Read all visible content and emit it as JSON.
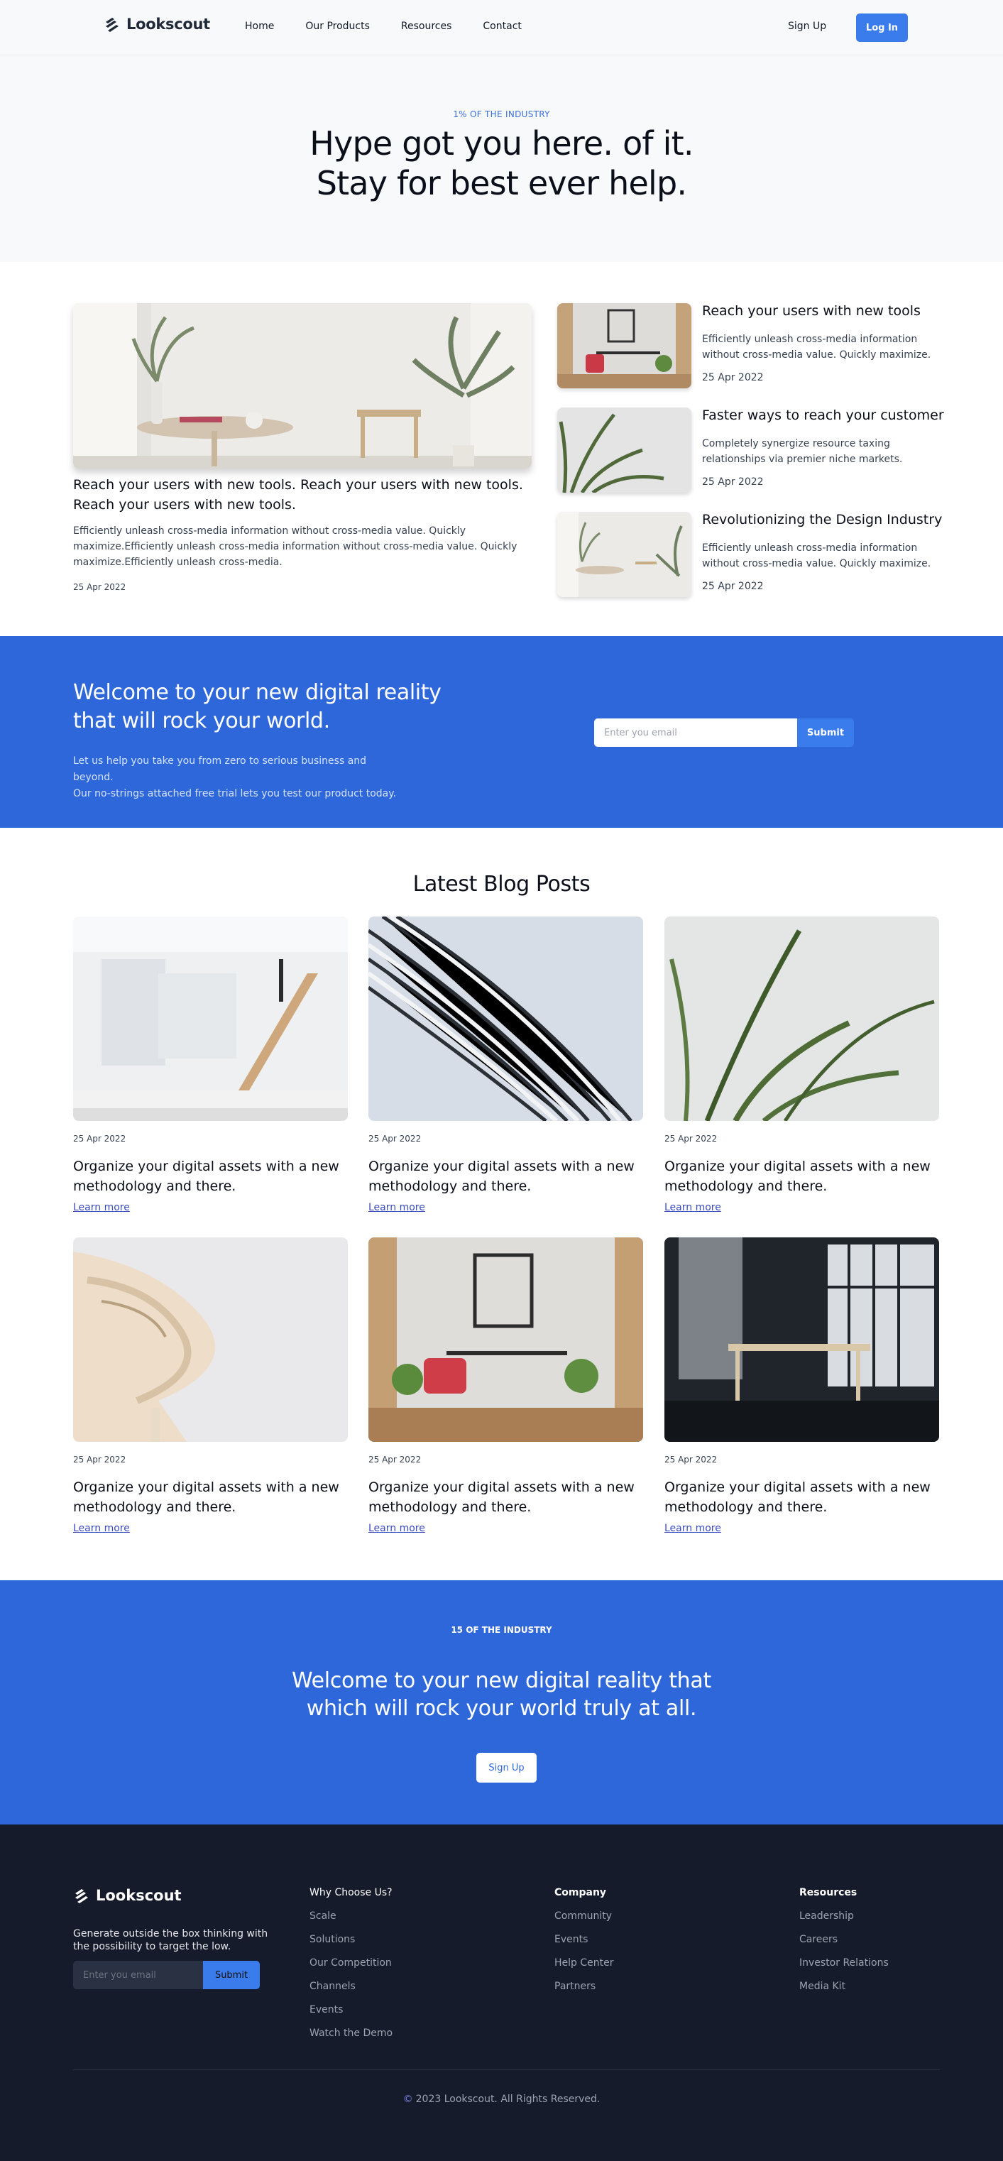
{
  "nav": {
    "brand": "Lookscout",
    "links": [
      "Home",
      "Our Products",
      "Resources",
      "Contact"
    ],
    "signup": "Sign Up",
    "login": "Log In"
  },
  "hero": {
    "eyebrow": "1% OF THE INDUSTRY",
    "title_line1": "Hype got you here. of it.",
    "title_line2": "Stay for best ever help."
  },
  "featured": {
    "main": {
      "title": "Reach your users with new tools. Reach your users with new tools. Reach your users with new tools.",
      "description": "Efficiently unleash cross-media information without cross-media value. Quickly maximize.Efficiently unleash cross-media information without cross-media value. Quickly maximize.Efficiently unleash cross-media.",
      "date": "25 Apr 2022"
    },
    "side": [
      {
        "title": "Reach your users with new tools",
        "description": "Efficiently unleash cross-media information without cross-media value. Quickly maximize.",
        "date": "25 Apr 2022"
      },
      {
        "title": "Faster ways to reach your customer",
        "description": "Completely synergize resource taxing relationships via premier niche markets.",
        "date": "25 Apr 2022"
      },
      {
        "title": "Revolutionizing the Design Industry",
        "description": "Efficiently unleash cross-media information without cross-media value. Quickly maximize.",
        "date": "25 Apr 2022"
      }
    ]
  },
  "cta": {
    "title": "Welcome to your new digital reality that will rock your world.",
    "text_line1": "Let us help you take you from zero to serious business and beyond.",
    "text_line2": "Our no-strings attached free trial lets you test our product today.",
    "email_placeholder": "Enter you email",
    "submit": "Submit"
  },
  "blog": {
    "heading": "Latest Blog Posts",
    "posts": [
      {
        "date": "25 Apr 2022",
        "title": "Organize your digital assets with a new methodology and there.",
        "link": "Learn more"
      },
      {
        "date": "25 Apr 2022",
        "title": "Organize your digital assets with a new methodology and there.",
        "link": "Learn more"
      },
      {
        "date": "25 Apr 2022",
        "title": "Organize your digital assets with a new methodology and there.",
        "link": "Learn more"
      },
      {
        "date": "25 Apr 2022",
        "title": "Organize your digital assets with a new methodology and there.",
        "link": "Learn more"
      },
      {
        "date": "25 Apr 2022",
        "title": "Organize your digital assets with a new methodology and there.",
        "link": "Learn more"
      },
      {
        "date": "25 Apr 2022",
        "title": "Organize your digital assets with a new methodology and there.",
        "link": "Learn more"
      }
    ]
  },
  "cta2": {
    "eyebrow": "15 OF THE INDUSTRY",
    "title_line1": "Welcome to your new digital reality that",
    "title_line2": "which will rock your world truly at all.",
    "button": "Sign Up"
  },
  "footer": {
    "brand": "Lookscout",
    "tagline": "Generate outside the box thinking with the possibility to target the low.",
    "email_placeholder": "Enter you email",
    "submit": "Submit",
    "columns": [
      {
        "heading": "Why Choose Us?",
        "items": [
          "Scale",
          "Solutions",
          "Our Competition",
          "Channels",
          "Events",
          "Watch the Demo"
        ]
      },
      {
        "heading": "Company",
        "items": [
          "Community",
          "Events",
          "Help Center",
          "Partners"
        ]
      },
      {
        "heading": "Resources",
        "items": [
          "Leadership",
          "Careers",
          "Investor Relations",
          "Media Kit"
        ]
      }
    ],
    "copyright": "2023 Lookscout. All Rights Reserved."
  },
  "colors": {
    "accent": "#2e67d9",
    "button": "#3b7ced",
    "footer_bg": "#161b2b",
    "hero_bg": "#f8f9fb"
  }
}
